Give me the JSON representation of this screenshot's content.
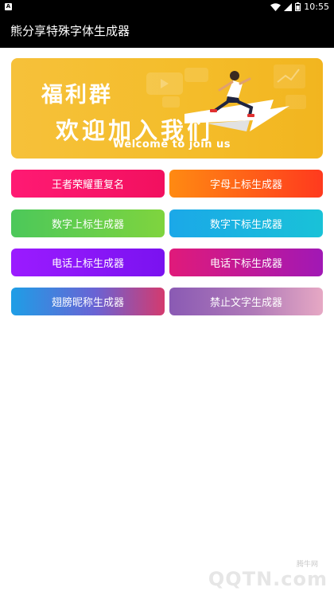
{
  "status_bar": {
    "time": "10:55",
    "notification_icon": "android-notification-icon",
    "icons": [
      "wifi-icon",
      "signal-icon",
      "battery-icon"
    ]
  },
  "app_bar": {
    "title": "熊分享特殊字体生成器"
  },
  "banner": {
    "title_line1": "福利群",
    "title_line2": "欢迎加入我们",
    "subtitle": "Welcome to join us"
  },
  "buttons": [
    {
      "label": "王者荣耀重复名"
    },
    {
      "label": "字母上标生成器"
    },
    {
      "label": "数字上标生成器"
    },
    {
      "label": "数字下标生成器"
    },
    {
      "label": "电话上标生成器"
    },
    {
      "label": "电话下标生成器"
    },
    {
      "label": "翅膀昵称生成器"
    },
    {
      "label": "禁止文字生成器"
    }
  ],
  "watermark": {
    "small": "腾牛网",
    "big": "QQTN.com"
  },
  "colors": {
    "banner": "#f4bd2b",
    "bar": "#000000"
  }
}
